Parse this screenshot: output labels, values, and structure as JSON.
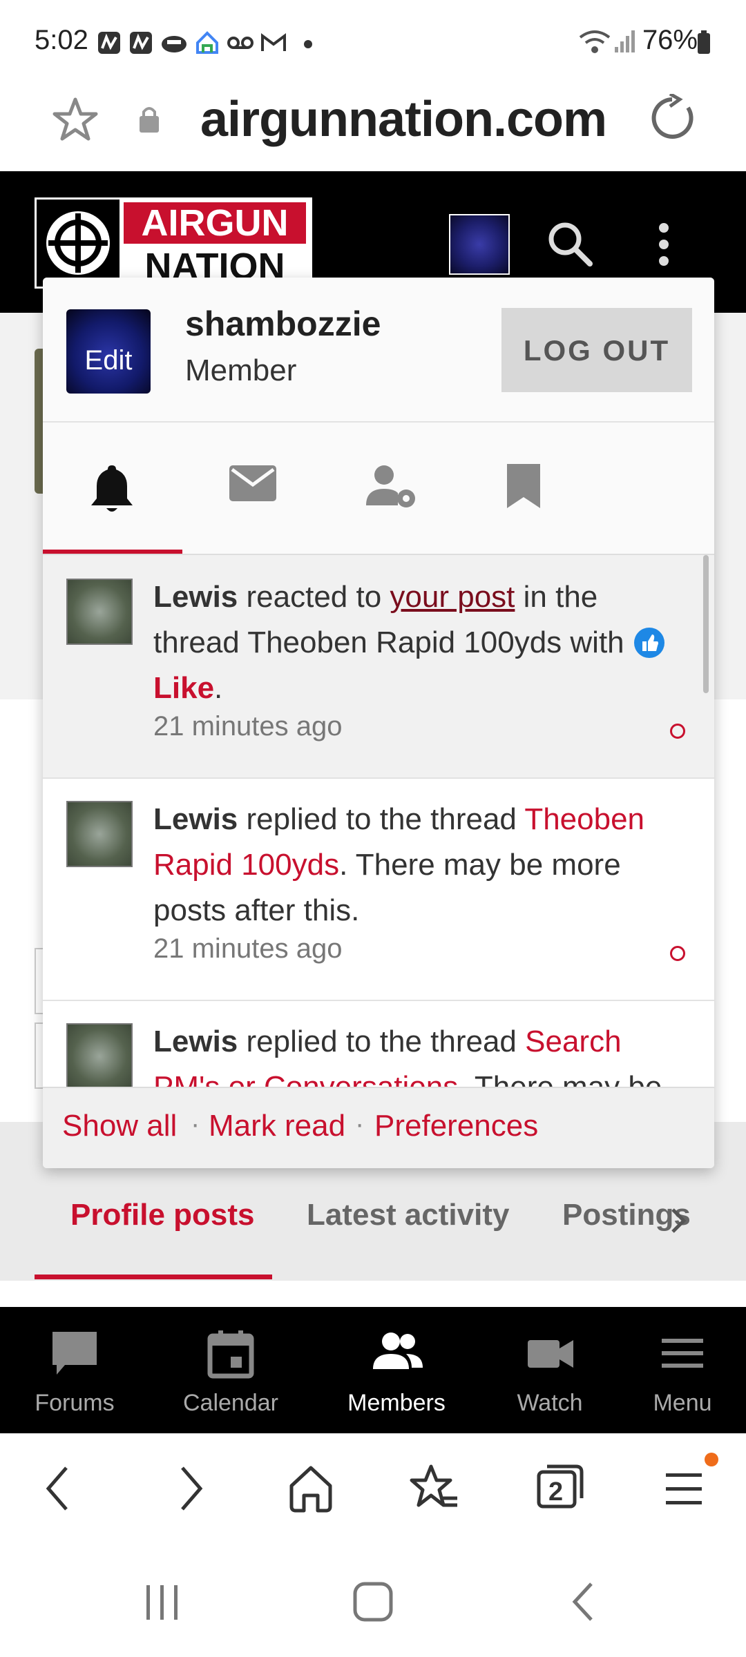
{
  "status_bar": {
    "time": "5:02",
    "battery": "76%",
    "notification_icons": [
      "app-icon",
      "app-icon",
      "wifi-calling-icon",
      "google-home-icon",
      "voicemail-icon",
      "gmail-icon",
      "dot-icon"
    ]
  },
  "browser": {
    "url": "airgunnation.com",
    "tab_count": "2"
  },
  "site": {
    "logo_top": "AIRGUN",
    "logo_bottom": "NATION"
  },
  "account_popup": {
    "avatar_edit_label": "Edit",
    "username": "shambozzie",
    "user_title": "Member",
    "logout_label": "LOG OUT",
    "tabs": [
      "alerts",
      "conversations",
      "account-settings",
      "bookmarks"
    ],
    "alerts": [
      {
        "user": "Lewis",
        "text_a": " reacted to ",
        "link": "your post",
        "text_b": " in the thread Theoben Rapid 100yds with ",
        "reaction": "Like",
        "end": ".",
        "time": "21 minutes ago"
      },
      {
        "user": "Lewis",
        "text_a": " replied to the thread ",
        "link": "Theoben Rapid 100yds",
        "text_b": ". There may be more posts after this.",
        "time": "21 minutes ago"
      },
      {
        "user": "Lewis",
        "text_a": " replied to the thread ",
        "link": "Search PM's or Conversations",
        "text_b": ". There may be"
      }
    ],
    "footer": {
      "show_all": "Show all",
      "mark_read": "Mark read",
      "preferences": "Preferences",
      "separator": "·"
    }
  },
  "profile_tabs": [
    "Profile posts",
    "Latest activity",
    "Postings"
  ],
  "bottom_nav": [
    "Forums",
    "Calendar",
    "Members",
    "Watch",
    "Menu"
  ],
  "colors": {
    "accent": "#c8102e",
    "header_bg": "#000000"
  }
}
